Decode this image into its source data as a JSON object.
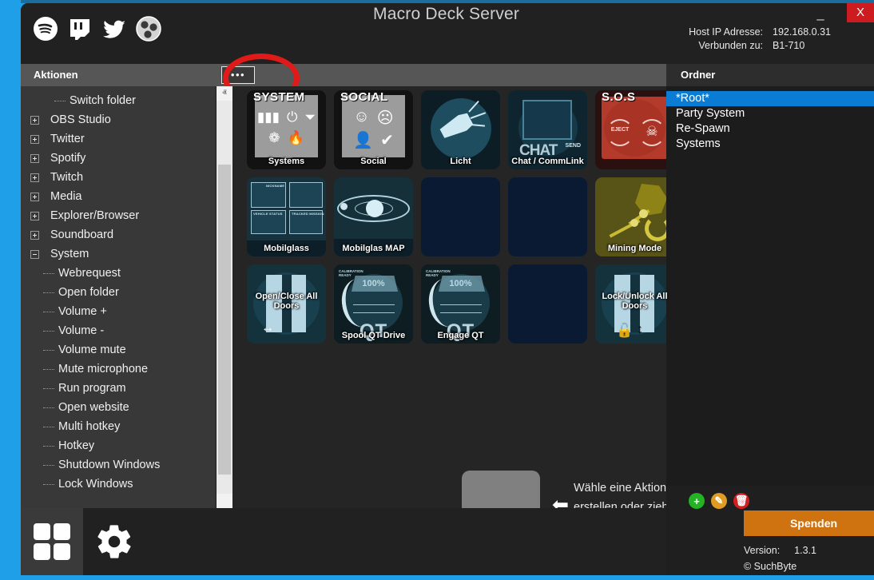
{
  "window": {
    "title": "Macro Deck Server",
    "minimize_label": "–",
    "close_label": "X"
  },
  "social_icons": [
    {
      "name": "spotify-icon",
      "label": "Spotify"
    },
    {
      "name": "twitch-icon",
      "label": "Twitch"
    },
    {
      "name": "twitter-icon",
      "label": "Twitter"
    },
    {
      "name": "obs-icon",
      "label": "OBS Studio"
    }
  ],
  "host_info": {
    "ip_label": "Host IP Adresse:",
    "ip_value": "192.168.0.31",
    "connected_label": "Verbunden zu:",
    "connected_value": "B1-710"
  },
  "headers": {
    "actions": "Aktionen",
    "folders": "Ordner",
    "more_button": "•••"
  },
  "tree": [
    {
      "label": "Switch folder",
      "level": 2,
      "type": "leaf"
    },
    {
      "label": "OBS Studio",
      "level": 1,
      "type": "collapsed"
    },
    {
      "label": "Twitter",
      "level": 1,
      "type": "collapsed"
    },
    {
      "label": "Spotify",
      "level": 1,
      "type": "collapsed"
    },
    {
      "label": "Twitch",
      "level": 1,
      "type": "collapsed"
    },
    {
      "label": "Media",
      "level": 1,
      "type": "collapsed"
    },
    {
      "label": "Explorer/Browser",
      "level": 1,
      "type": "collapsed"
    },
    {
      "label": "Soundboard",
      "level": 1,
      "type": "collapsed"
    },
    {
      "label": "System",
      "level": 1,
      "type": "expanded"
    },
    {
      "label": "Webrequest",
      "level": 2,
      "type": "leaf"
    },
    {
      "label": "Open folder",
      "level": 2,
      "type": "leaf"
    },
    {
      "label": "Volume +",
      "level": 2,
      "type": "leaf"
    },
    {
      "label": "Volume -",
      "level": 2,
      "type": "leaf"
    },
    {
      "label": "Volume mute",
      "level": 2,
      "type": "leaf"
    },
    {
      "label": "Mute microphone",
      "level": 2,
      "type": "leaf"
    },
    {
      "label": "Run program",
      "level": 2,
      "type": "leaf"
    },
    {
      "label": "Open website",
      "level": 2,
      "type": "leaf"
    },
    {
      "label": "Multi hotkey",
      "level": 2,
      "type": "leaf"
    },
    {
      "label": "Hotkey",
      "level": 2,
      "type": "leaf"
    },
    {
      "label": "Shutdown Windows",
      "level": 2,
      "type": "leaf"
    },
    {
      "label": "Lock Windows",
      "level": 2,
      "type": "leaf"
    }
  ],
  "scrollbar": {
    "up": "ⱏ",
    "down": "ⱟ"
  },
  "deck_buttons": [
    {
      "label": "Systems",
      "style": "systems",
      "header": "SYSTEM",
      "empty": false
    },
    {
      "label": "Social",
      "style": "social",
      "header": "SOCIAL",
      "empty": false
    },
    {
      "label": "Licht",
      "style": "licht",
      "header": "",
      "empty": false
    },
    {
      "label": "Chat / CommLink",
      "style": "chat",
      "header": "CHAT",
      "empty": false
    },
    {
      "label": "",
      "style": "sos",
      "header": "S.O.S",
      "empty": false
    },
    {
      "label": "Mobilglass",
      "style": "mobil",
      "header": "",
      "empty": false
    },
    {
      "label": "Mobilglas MAP",
      "style": "map",
      "header": "",
      "empty": false
    },
    {
      "label": "",
      "style": "empty",
      "header": "",
      "empty": true
    },
    {
      "label": "",
      "style": "empty",
      "header": "",
      "empty": true
    },
    {
      "label": "Mining Mode",
      "style": "mining",
      "header": "",
      "empty": false
    },
    {
      "label": "Open/Close All Doors",
      "style": "doors",
      "header": "",
      "empty": false
    },
    {
      "label": "Spool QT Drive",
      "style": "qt",
      "header": "QT",
      "empty": false,
      "pct": "100%",
      "cal": "CALIBRATION\nREADY"
    },
    {
      "label": "Engage QT",
      "style": "qt",
      "header": "QT",
      "empty": false,
      "pct": "100%",
      "cal": "CALIBRATION\nREADY"
    },
    {
      "label": "",
      "style": "empty",
      "header": "",
      "empty": true
    },
    {
      "label": "Lock/Unlock All Doors",
      "style": "lockdoors",
      "header": "",
      "empty": false
    }
  ],
  "deck_extra": {
    "sos_eject": "EJECT",
    "chat_send": "SEND",
    "mg_labels": [
      "NICKNAME",
      "VEHICLE STATUS",
      "TRACKED MISSION"
    ]
  },
  "instruction": {
    "text": "Wähle eine Aktion aus der Liste um einen neuen Button zu erstellen oder ziehe einen existierenden Button um ihn zu bearbeiten",
    "arrow": "⬅"
  },
  "folders": [
    {
      "label": "*Root*",
      "selected": true
    },
    {
      "label": "Party System",
      "selected": false
    },
    {
      "label": "Re-Spawn",
      "selected": false
    },
    {
      "label": "Systems",
      "selected": false
    }
  ],
  "folder_tools": [
    {
      "name": "add-folder-icon",
      "glyph": "+"
    },
    {
      "name": "edit-folder-icon",
      "glyph": "✎"
    },
    {
      "name": "delete-folder-icon",
      "glyph": "🗑"
    }
  ],
  "footer": {
    "donate_label": "Spenden",
    "version_label": "Version:",
    "version_value": "1.3.1",
    "copyright": "© SuchByte"
  },
  "bottom_nav": [
    {
      "name": "grid-view-icon",
      "active": true
    },
    {
      "name": "settings-gear-icon",
      "active": false
    }
  ],
  "colors": {
    "accent_blue": "#1e9fe8",
    "selection_blue": "#0a7cd4",
    "donate_orange": "#cf7310",
    "close_red": "#cc1c20",
    "annotation_red": "#e01a18"
  }
}
